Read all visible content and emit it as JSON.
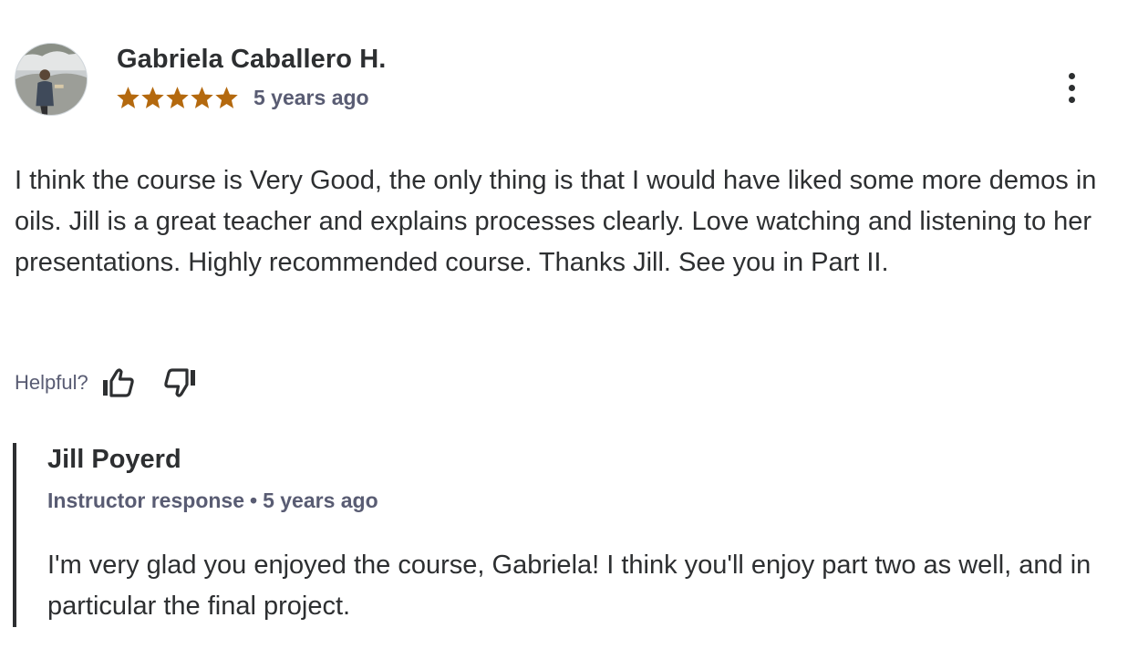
{
  "review": {
    "reviewer_name": "Gabriela Caballero H.",
    "avatar": "user-avatar-photo",
    "rating": 5,
    "rating_max": 5,
    "star_color": "#b4690e",
    "time_ago": "5 years ago",
    "more_icon": "more-options-icon",
    "body": "I think the course is Very Good, the only thing is that I would have liked some more demos in oils. Jill is a great teacher and explains processes clearly. Love watching and listening to her presentations. Highly recommended course. Thanks Jill. See you in Part II.",
    "helpful_label": "Helpful?",
    "thumbs_up_icon": "thumbs-up-icon",
    "thumbs_down_icon": "thumbs-down-icon"
  },
  "response": {
    "name": "Jill Poyerd",
    "label": "Instructor response",
    "separator": "•",
    "time_ago": "5 years ago",
    "body": "I'm very glad you enjoyed the course, Gabriela! I think you'll enjoy part two as well, and in particular the final project."
  },
  "colors": {
    "text": "#2d2f31",
    "muted": "#595c73",
    "star": "#b4690e"
  }
}
